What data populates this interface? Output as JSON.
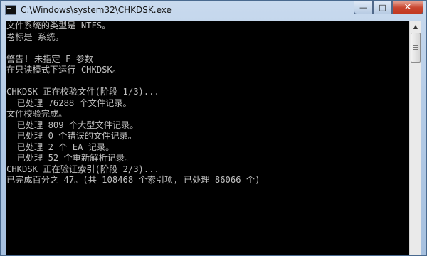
{
  "window": {
    "title": "C:\\Windows\\system32\\CHKDSK.exe",
    "controls": {
      "minimize": "—",
      "maximize": "□",
      "close": "✕"
    }
  },
  "icons": {
    "app": "cmd-icon",
    "scroll_up": "chevron-up-icon"
  },
  "console": {
    "lines": [
      "文件系统的类型是 NTFS。",
      "卷标是 系统。",
      "",
      "警告! 未指定 F 参数",
      "在只读模式下运行 CHKDSK。",
      "",
      "CHKDSK 正在校验文件(阶段 1/3)...",
      "  已处理 76288 个文件记录。",
      "文件校验完成。",
      "  已处理 809 个大型文件记录。",
      "  已处理 0 个错误的文件记录。",
      "  已处理 2 个 EA 记录。",
      "  已处理 52 个重新解析记录。",
      "CHKDSK 正在验证索引(阶段 2/3)...",
      "已完成百分之 47。(共 108468 个索引项, 已处理 86066 个)"
    ]
  },
  "colors": {
    "console_bg": "#000000",
    "console_fg": "#c0c0c0",
    "close_button": "#c8452f"
  }
}
